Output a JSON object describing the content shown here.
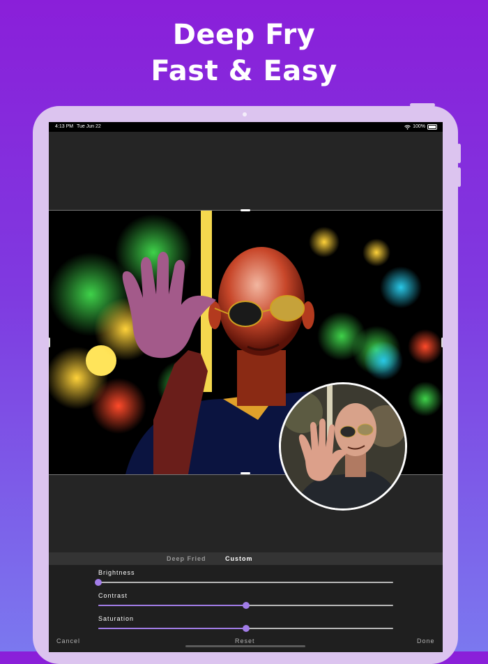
{
  "promo": {
    "line1": "Deep Fry",
    "line2": "Fast & Easy"
  },
  "status_bar": {
    "time": "4:13 PM",
    "date": "Tue Jun 22",
    "battery": "100%",
    "icons": [
      "wifi-icon",
      "battery-icon"
    ]
  },
  "tabs": [
    {
      "label": "Deep Fried",
      "selected": false
    },
    {
      "label": "Custom",
      "selected": true
    }
  ],
  "sliders": [
    {
      "label": "Brightness",
      "value": 0.0
    },
    {
      "label": "Contrast",
      "value": 0.5
    },
    {
      "label": "Saturation",
      "value": 0.5
    }
  ],
  "bottom_bar": {
    "cancel_label": "Cancel",
    "reset_label": "Reset",
    "done_label": "Done"
  },
  "colors": {
    "accent": "#a27de8",
    "background_top": "#8a1fd9",
    "background_bottom": "#7b78ef",
    "device_frame": "#dcc4ef"
  }
}
